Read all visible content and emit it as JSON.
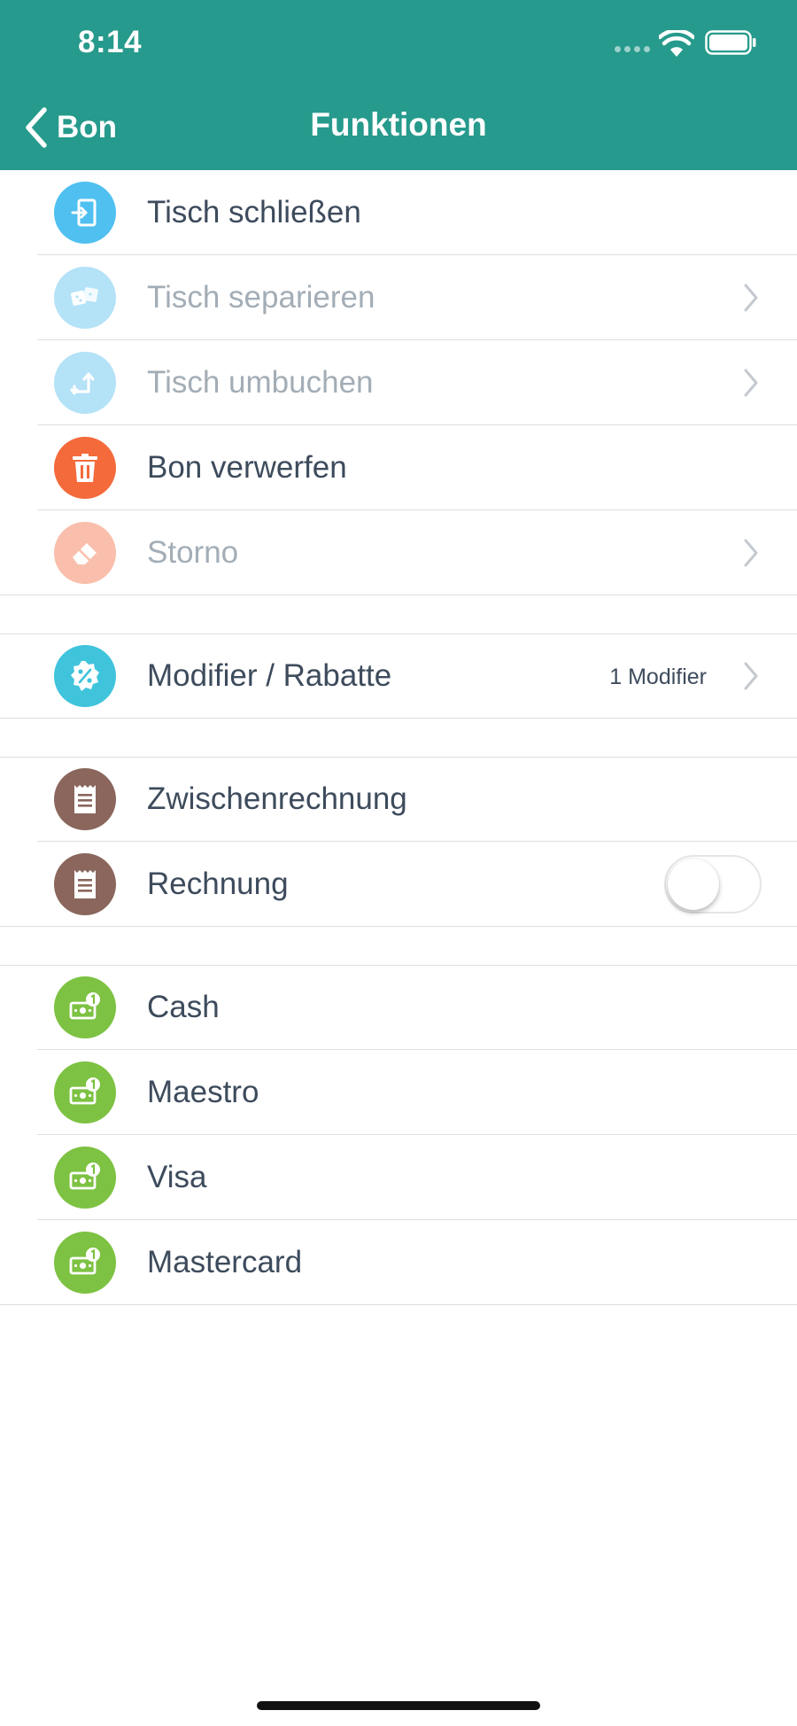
{
  "status_bar": {
    "time": "8:14"
  },
  "nav": {
    "back_label": "Bon",
    "title": "Funktionen"
  },
  "colors": {
    "header": "#269a8c",
    "blue": "#4fc0f0",
    "blue_disabled": "#b4e2f7",
    "orange": "#f46a3b",
    "orange_disabled": "#f9bfac",
    "teal": "#3fc4dc",
    "brown": "#8a665c",
    "green": "#7dc242"
  },
  "section_table": {
    "items": [
      {
        "label": "Tisch schließen",
        "icon": "door-enter-icon",
        "enabled": true
      },
      {
        "label": "Tisch separieren",
        "icon": "split-table-icon",
        "enabled": false
      },
      {
        "label": "Tisch umbuchen",
        "icon": "transfer-arrows-icon",
        "enabled": false
      },
      {
        "label": "Bon verwerfen",
        "icon": "trash-icon",
        "enabled": true
      },
      {
        "label": "Storno",
        "icon": "eraser-icon",
        "enabled": false
      }
    ]
  },
  "section_modifier": {
    "label": "Modifier / Rabatte",
    "icon": "percent-badge-icon",
    "detail": "1 Modifier"
  },
  "section_invoice": {
    "items": [
      {
        "label": "Zwischenrechnung",
        "icon": "receipt-icon"
      },
      {
        "label": "Rechnung",
        "icon": "receipt-icon",
        "toggle_on": false
      }
    ]
  },
  "section_payment": {
    "items": [
      {
        "label": "Cash",
        "icon": "cash-icon"
      },
      {
        "label": "Maestro",
        "icon": "cash-icon"
      },
      {
        "label": "Visa",
        "icon": "cash-icon"
      },
      {
        "label": "Mastercard",
        "icon": "cash-icon"
      }
    ]
  }
}
